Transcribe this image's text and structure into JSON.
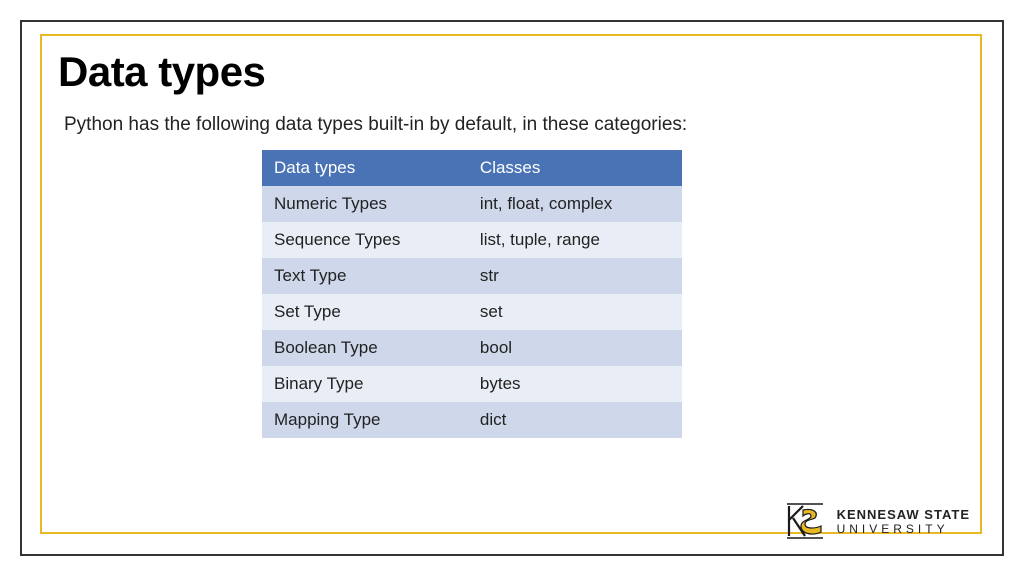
{
  "title": "Data types",
  "intro": "Python has the following data types built-in by default, in these categories:",
  "table": {
    "headers": [
      "Data types",
      "Classes"
    ],
    "rows": [
      [
        "Numeric Types",
        "int, float, complex"
      ],
      [
        "Sequence Types",
        "list, tuple, range"
      ],
      [
        "Text Type",
        "str"
      ],
      [
        "Set Type",
        "set"
      ],
      [
        "Boolean Type",
        "bool"
      ],
      [
        "Binary Type",
        "bytes"
      ],
      [
        "Mapping Type",
        "dict"
      ]
    ]
  },
  "logo": {
    "line1": "KENNESAW STATE",
    "line2": "UNIVERSITY"
  }
}
